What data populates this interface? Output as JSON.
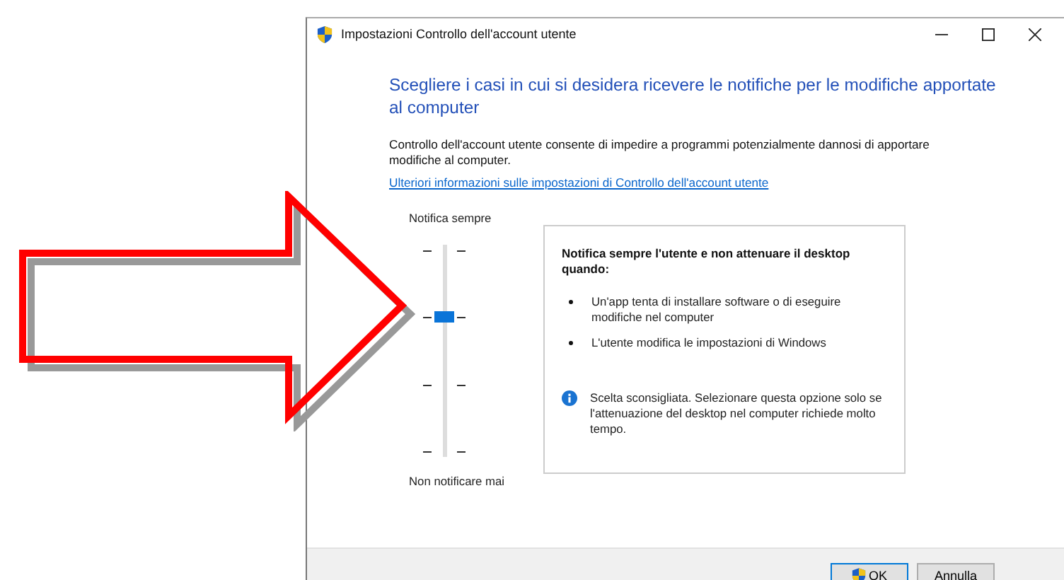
{
  "window": {
    "title": "Impostazioni Controllo dell'account utente"
  },
  "heading": "Scegliere i casi in cui si desidera ricevere le notifiche per le modifiche apportate al computer",
  "description": "Controllo dell'account utente consente di impedire a programmi potenzialmente dannosi di apportare modifiche al computer.",
  "link": "Ulteriori informazioni sulle impostazioni di Controllo dell'account utente",
  "slider": {
    "top_label": "Notifica sempre",
    "bottom_label": "Non notificare mai",
    "level": 0.67
  },
  "info_panel": {
    "title": "Notifica sempre l'utente e non attenuare il desktop quando:",
    "bullets": [
      "Un'app tenta di installare software o di eseguire modifiche nel computer",
      "L'utente modifica le impostazioni di Windows"
    ],
    "note": "Scelta sconsigliata. Selezionare questa opzione solo se l'attenuazione del desktop nel computer richiede molto tempo."
  },
  "buttons": [
    {
      "label": "OK",
      "kind": "shield",
      "default": true
    },
    {
      "label": "Annulla",
      "kind": "plain",
      "default": false
    }
  ]
}
